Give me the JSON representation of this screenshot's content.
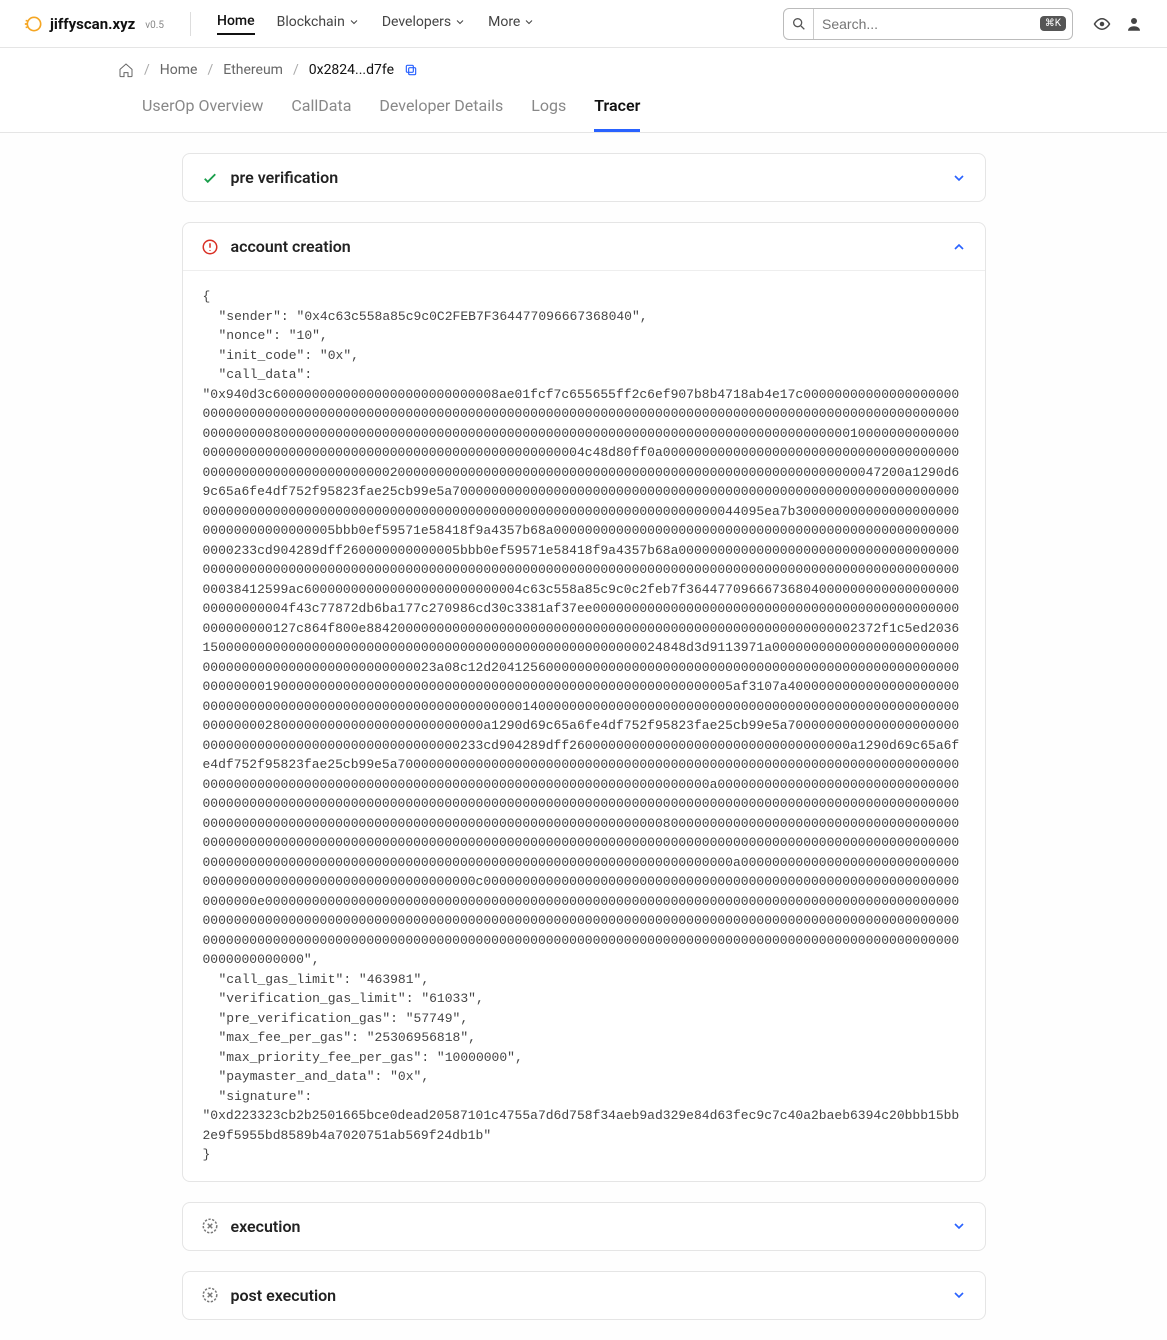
{
  "brand": {
    "name": "jiffyscan.xyz",
    "version": "v0.5"
  },
  "nav": {
    "home": "Home",
    "blockchain": "Blockchain",
    "developers": "Developers",
    "more": "More"
  },
  "search": {
    "placeholder": "Search...",
    "hint": "⌘K"
  },
  "breadcrumbs": {
    "home": "Home",
    "chain": "Ethereum",
    "current": "0x2824...d7fe"
  },
  "tabs": {
    "overview": "UserOp Overview",
    "calldata": "CallData",
    "devdetails": "Developer Details",
    "logs": "Logs",
    "tracer": "Tracer"
  },
  "panels": {
    "pre": {
      "title": "pre verification"
    },
    "account": {
      "title": "account creation",
      "open_brace": "{",
      "sender": "\"sender\": \"0x4c63c558a85c9c0C2FEB7F364477096667368040\",",
      "nonce": "\"nonce\": \"10\",",
      "init_code": "\"init_code\": \"0x\",",
      "call_data_label": "\"call_data\":",
      "call_data_value": "\"0x940d3c60000000000000000000000000008ae01fcf7c655655ff2c6ef907b8b4718ab4e17c00000000000000000000000000000000000000000000000000000000000000000000000000000000000000000000000000000000000000000000000000000080000000000000000000000000000000000000000000000000000000000000000000000000100000000000000000000000000000000000000000000000000000000000004c48d80ff0a00000000000000000000000000000000000000000000000000000000000000200000000000000000000000000000000000000000000000000000000000047200a1290d69c65a6fe4df752f95823fae25cb99e5a70000000000000000000000000000000000000000000000000000000000000000000000000000000000000000000000000000000000000000000000000000000000044095ea7b30000000000000000000000000000000000005bbb0ef59571e58418f9a4357b68a00000000000000000000000000000000000000000000000000000000233cd904289dff260000000000005bbb0ef59571e58418f9a4357b68a000000000000000000000000000000000000000000000000000000000000000000000000000000000000000000000000000000000000000000000000000000000000000038412599ac6000000000000000000000000004c63c558a85c9c0c2feb7f3644770966673680400000000000000000000000000004f43c77872db6ba177c270986cd30c3381af37ee00000000000000000000000000000000000000000000000000000000127c864f800e884200000000000000000000000000000000000000000000000000000000002372f1c5ed203615000000000000000000000000000000000000000000000000000000024848d3d9113971a000000000000000000000000000000000000000000000000000023a08c12d20412560000000000000000000000000000000000000000000000000000000000000190000000000000000000000000000000000000000000000000000000005af3107a40000000000000000000000000000000000000000000000000000000000000014000000000000000000000000000000000000000000000000000000000000002800000000000000000000000000a1290d69c65a6fe4df752f95823fae25cb99e5a7000000000000000000000000000000000000000000000000000000233cd904289dff260000000000000000000000000000000000a1290d69c65a6fe4df752f95823fae25cb99e5a70000000000000000000000000000000000000000000000000000000000000000000000000000000000000000000000000000000000000000000000000000000000000000a000000000000000000000000000000000000000000000000000000000000000000000000000000000000000000000000000000000000000000000000000000000000000000000000000000000000000000000000000000000000000000080000000000000000000000000000000000000000000000000000000000000000000000000000000000000000000000000000000000000000000000000000000000000000000000000000000000000000000000000000000000000000000000000000000000a000000000000000000000000000000000000000000000000000000000000000c00000000000000000000000000000000000000000000000000000000000000000000e00000000000000000000000000000000000000000000000000000000000000000000000000000000000000000000000000000000000000000000000000000000000000000000000000000000000000000000000000000000000000000000000000000000000000000000000000000000000000000000000000000000000000000000000000000000000000000000000000000000\",",
      "call_gas_limit": "\"call_gas_limit\": \"463981\",",
      "verification_gas_limit": "\"verification_gas_limit\": \"61033\",",
      "pre_verification_gas": "\"pre_verification_gas\": \"57749\",",
      "max_fee_per_gas": "\"max_fee_per_gas\": \"25306956818\",",
      "max_priority_fee_per_gas": "\"max_priority_fee_per_gas\": \"10000000\",",
      "paymaster_and_data": "\"paymaster_and_data\": \"0x\",",
      "signature_label": "\"signature\":",
      "signature_value": "\"0xd223323cb2b2501665bce0dead20587101c4755a7d6d758f34aeb9ad329e84d63fec9c7c40a2baeb6394c20bbb15bb2e9f5955bd8589b4a7020751ab569f24db1b\"",
      "close_brace": "}"
    },
    "exec": {
      "title": "execution"
    },
    "post": {
      "title": "post execution"
    }
  }
}
